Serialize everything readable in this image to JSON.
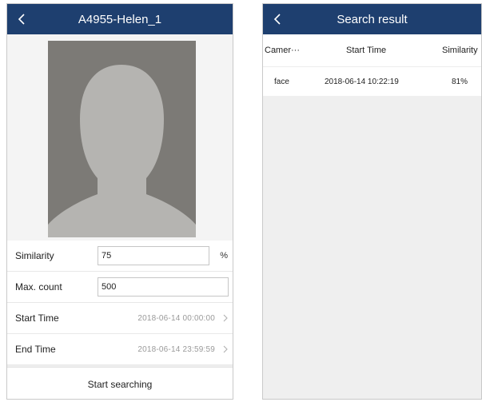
{
  "left_screen": {
    "title": "A4955-Helen_1",
    "icons": {
      "back": "chevron-left-icon",
      "photo": "person-silhouette",
      "row_arrow": "chevron-right-icon"
    },
    "form": {
      "similarity": {
        "label": "Similarity",
        "value": "75",
        "unit": "%"
      },
      "max_count": {
        "label": "Max. count",
        "value": "500"
      },
      "start_time": {
        "label": "Start Time",
        "value": "2018-06-14 00:00:00"
      },
      "end_time": {
        "label": "End Time",
        "value": "2018-06-14 23:59:59"
      }
    },
    "start_button": "Start searching"
  },
  "right_screen": {
    "title": "Search result",
    "columns": [
      "Camer···",
      "Start Time",
      "Similarity"
    ],
    "rows": [
      {
        "camera": "face",
        "start_time": "2018-06-14 10:22:19",
        "similarity": "81%"
      }
    ]
  },
  "colors": {
    "navbar": "#1e3f6f",
    "background": "#efefef",
    "photo_bg": "#7c7a76",
    "silhouette": "#b5b4b1",
    "muted_text": "#9a9a9a"
  }
}
